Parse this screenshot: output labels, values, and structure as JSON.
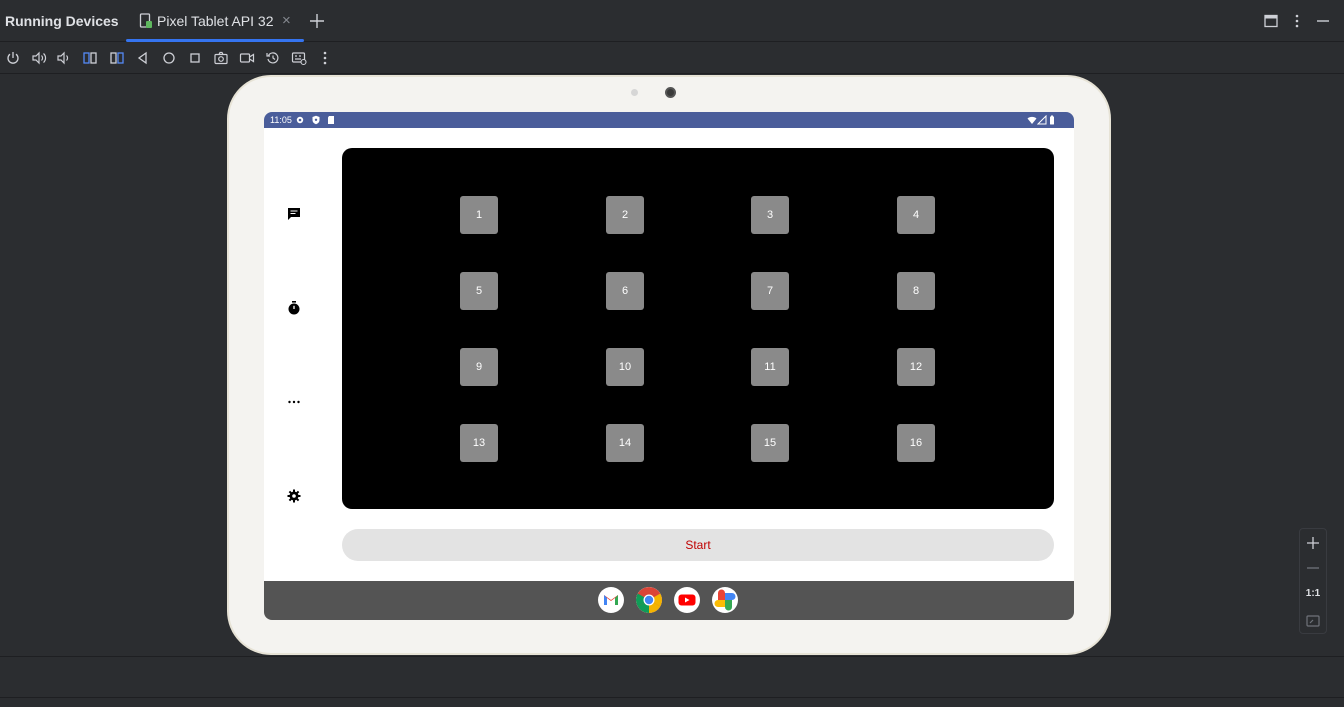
{
  "window": {
    "title": "Running Devices",
    "tab_label": "Pixel Tablet API 32",
    "tab_close": "×"
  },
  "toolbar_icons": [
    "power-icon",
    "volume-up-icon",
    "volume-down-icon",
    "rotate-left-icon",
    "rotate-right-icon",
    "back-icon",
    "home-icon",
    "overview-icon",
    "screenshot-icon",
    "screen-record-icon",
    "snapshot-icon",
    "extended-controls-icon",
    "more-options-icon"
  ],
  "device": {
    "status_time": "11:05",
    "board_cells": [
      "1",
      "2",
      "3",
      "4",
      "5",
      "6",
      "7",
      "8",
      "9",
      "10",
      "11",
      "12",
      "13",
      "14",
      "15",
      "16"
    ],
    "start_label": "Start",
    "rail_icons": [
      "chat-icon",
      "timer-icon",
      "more-horiz-icon",
      "settings-icon"
    ],
    "taskbar_apps": [
      "gmail-icon",
      "chrome-icon",
      "youtube-icon",
      "photos-icon"
    ]
  },
  "zoom": {
    "one_to_one": "1:1"
  },
  "colors": {
    "accent": "#3574f0",
    "status_bar": "#4a5d9a",
    "board": "#000000",
    "cell": "#8a8a8a",
    "start_text": "#c00000"
  }
}
